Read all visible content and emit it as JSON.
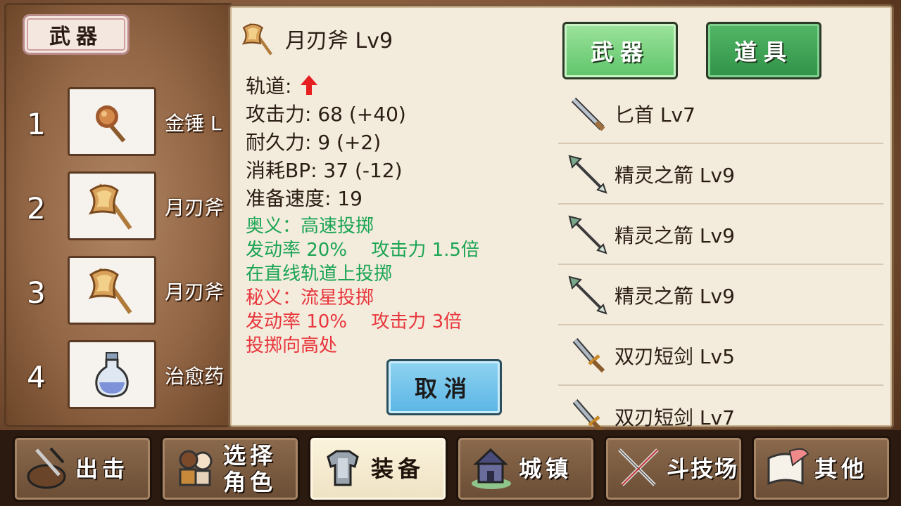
{
  "left_panel": {
    "header": "武器",
    "slots": [
      {
        "num": "1",
        "name": "金锤 L",
        "icon": "golden-hammer-icon"
      },
      {
        "num": "2",
        "name": "月刃斧",
        "icon": "moon-axe-icon"
      },
      {
        "num": "3",
        "name": "月刃斧",
        "icon": "moon-axe-icon"
      },
      {
        "num": "4",
        "name": "治愈药",
        "icon": "potion-icon"
      }
    ]
  },
  "detail": {
    "title": "月刃斧 Lv9",
    "trajectory_label": "轨道:",
    "attack": "攻击力: 68 (+40)",
    "durability": "耐久力: 9 (+2)",
    "bp_cost": "消耗BP: 37 (-12)",
    "prep_speed": "准备速度: 19",
    "secret_art": {
      "line1": "奥义：高速投掷",
      "line2": "发动率 20%　 攻击力 1.5倍",
      "line3": "在直线轨道上投掷"
    },
    "hidden_art": {
      "line1": "秘义：流星投掷",
      "line2": "发动率 10%　 攻击力 3倍",
      "line3": "投掷向高处"
    },
    "cancel_label": "取消"
  },
  "tabs": {
    "weapon": "武器",
    "item": "道具"
  },
  "item_list": [
    {
      "label": "匕首 Lv7",
      "icon": "dagger-icon"
    },
    {
      "label": "精灵之箭 Lv9",
      "icon": "arrow-icon"
    },
    {
      "label": "精灵之箭 Lv9",
      "icon": "arrow-icon"
    },
    {
      "label": "精灵之箭 Lv9",
      "icon": "arrow-icon"
    },
    {
      "label": "双刃短剑 Lv5",
      "icon": "twin-blade-icon"
    },
    {
      "label": "双刃短剑 Lv7",
      "icon": "twin-blade-icon"
    }
  ],
  "nav": {
    "sortie": "出击",
    "select_char_line1": "选择",
    "select_char_line2": "角色",
    "equip": "装备",
    "town": "城镇",
    "arena": "斗技场",
    "other": "其他"
  },
  "colors": {
    "green_text": "#1aa453",
    "red_text": "#e8363c",
    "trajectory_arrow": "#e62020"
  }
}
